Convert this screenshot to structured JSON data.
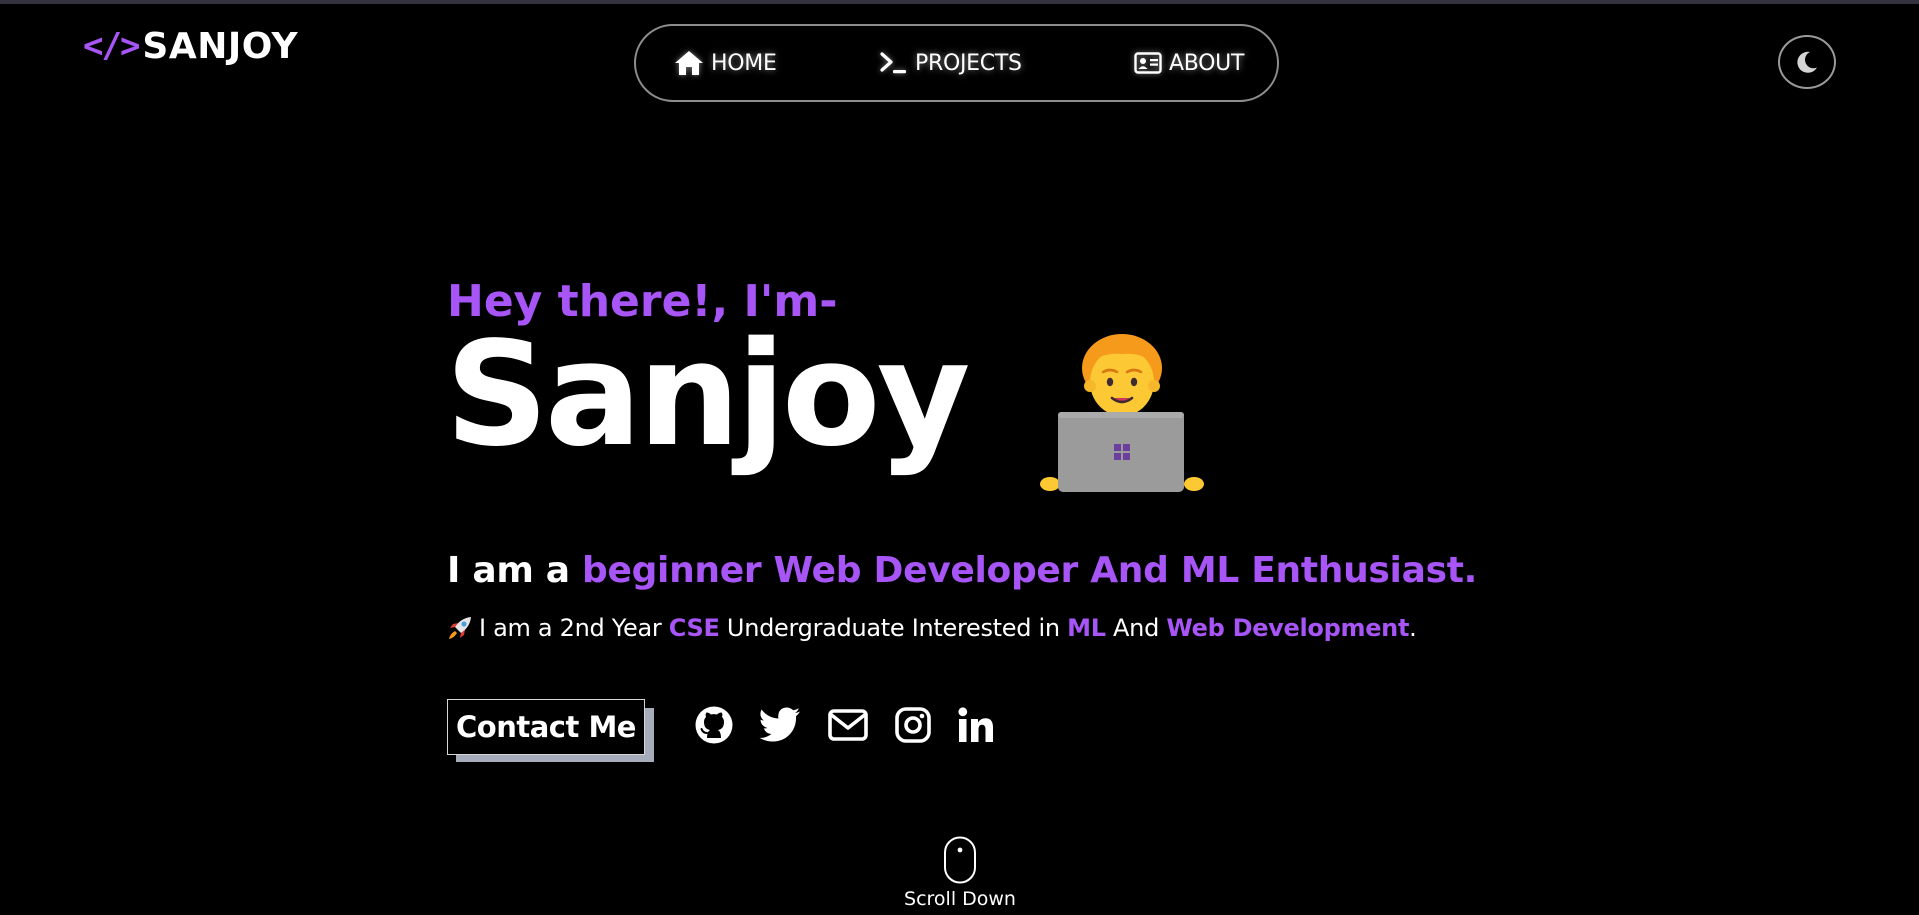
{
  "logo": {
    "mark": "</>",
    "text": "SANJOY"
  },
  "nav": {
    "items": [
      {
        "label": "HOME",
        "icon": "home-icon"
      },
      {
        "label": "PROJECTS",
        "icon": "terminal-icon"
      },
      {
        "label": "ABOUT",
        "icon": "id-card-icon"
      }
    ]
  },
  "theme_toggle": {
    "icon": "moon-icon"
  },
  "hero": {
    "greeting": "Hey there!, I'm-",
    "name": "Sanjoy",
    "emoji": "technologist-emoji",
    "tagline_prefix": "I am a ",
    "tagline_highlight": "beginner Web Developer And ML Enthusiast.",
    "desc": {
      "icon": "rocket-emoji",
      "part1": "I am a 2nd Year ",
      "hl1": "CSE",
      "part2": " Undergraduate Interested in ",
      "hl2": "ML",
      "part3": " And ",
      "hl3": "Web Development",
      "part4": "."
    }
  },
  "contact": {
    "label": "Contact Me"
  },
  "social": [
    "github-icon",
    "twitter-icon",
    "mail-icon",
    "instagram-icon",
    "linkedin-icon"
  ],
  "scroll": {
    "label": "Scroll Down",
    "icon": "mouse-icon"
  },
  "colors": {
    "accent": "#a855f7",
    "background": "#000000",
    "text": "#ffffff",
    "button_shadow": "#a6acb9"
  }
}
